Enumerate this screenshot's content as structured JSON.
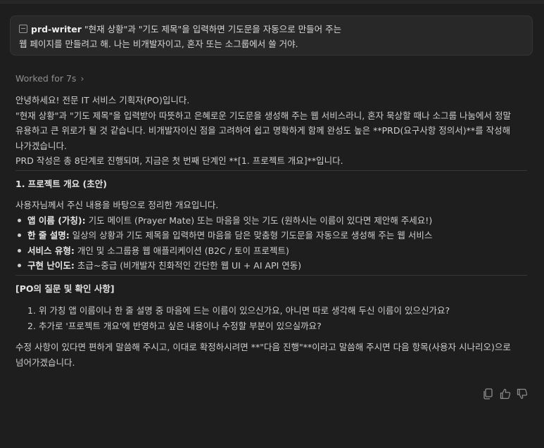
{
  "user_message": {
    "file_chip_icon": "file-icon",
    "file_chip": "prd-writer",
    "line1_rest": " \"현재 상황\"과 \"기도 제목\"을 입력하면 기도문을 자동으로 만들어 주는",
    "line2": "웹 페이지를 만들려고 해. 나는 비개발자이고, 혼자 또는 소그룹에서 쓸 거야."
  },
  "worked": {
    "label": "Worked for 7s",
    "chevron": "›"
  },
  "response": {
    "paragraphs": [
      "안녕하세요! 전문 IT 서비스 기획자(PO)입니다.",
      "\"현재 상황\"과 \"기도 제목\"을 입력받아 따뜻하고 은혜로운 기도문을 생성해 주는 웹 서비스라니, 혼자 묵상할 때나 소그룹 나눔에서 정말",
      "유용하고 큰 위로가 될 것 같습니다. 비개발자이신 점을 고려하여 쉽고 명확하게 함께 완성도 높은 **PRD(요구사항 정의서)**를 작성해",
      "나가겠습니다.",
      "PRD 작성은 총 8단계로 진행되며, 지금은 첫 번째 단계인 **[1. 프로젝트 개요]**입니다."
    ],
    "section_title": "1. 프로젝트 개요 (초안)",
    "intro": "사용자님께서 주신 내용을 바탕으로 정리한 개요입니다.",
    "bullets": [
      {
        "label": "앱 이름 (가칭):",
        "text": " 기도 메이트 (Prayer Mate) 또는 마음을 잇는 기도 (원하시는 이름이 있다면 제안해 주세요!)"
      },
      {
        "label": "한 줄 설명:",
        "text": " 일상의 상황과 기도 제목을 입력하면 마음을 담은 맞춤형 기도문을 자동으로 생성해 주는 웹 서비스"
      },
      {
        "label": "서비스 유형:",
        "text": " 개인 및 소그룹용 웹 애플리케이션 (B2C / 토이 프로젝트)"
      },
      {
        "label": "구현 난이도:",
        "text": " 초급~중급 (비개발자 친화적인 간단한 웹 UI + AI API 연동)"
      }
    ],
    "questions_title": "[PO의 질문 및 확인 사항]",
    "questions": [
      {
        "num": "1.",
        "text": "위 가칭 앱 이름이나 한 줄 설명 중 마음에 드는 이름이 있으신가요, 아니면 따로 생각해 두신 이름이 있으신가요?"
      },
      {
        "num": "2.",
        "text": "추가로 '프로젝트 개요'에 반영하고 싶은 내용이나 수정할 부분이 있으실까요?"
      }
    ],
    "closing_line1": "수정 사항이 있다면 편하게 말씀해 주시고, 이대로 확정하시려면 **\"다음 진행\"**이라고 말씀해 주시면 다음 항목(사용자 시나리오)으로",
    "closing_line2": "넘어가겠습니다."
  },
  "actions": {
    "copy_icon": "copy-icon",
    "thumbs_up_icon": "thumbs-up-icon",
    "thumbs_down_icon": "thumbs-down-icon"
  }
}
